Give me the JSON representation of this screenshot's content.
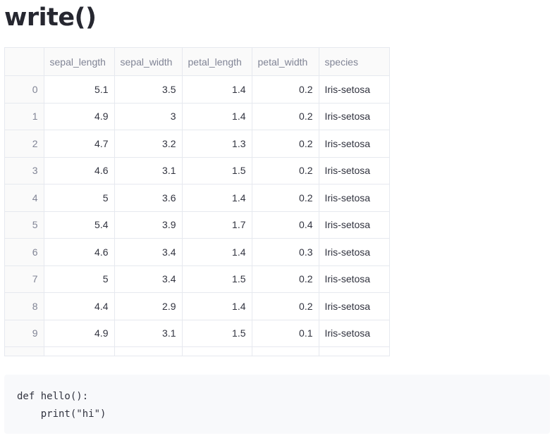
{
  "page": {
    "title": "write()"
  },
  "table": {
    "columns": [
      "",
      "sepal_length",
      "sepal_width",
      "petal_length",
      "petal_width",
      "species"
    ],
    "rows": [
      [
        "0",
        "5.1",
        "3.5",
        "1.4",
        "0.2",
        "Iris-setosa"
      ],
      [
        "1",
        "4.9",
        "3",
        "1.4",
        "0.2",
        "Iris-setosa"
      ],
      [
        "2",
        "4.7",
        "3.2",
        "1.3",
        "0.2",
        "Iris-setosa"
      ],
      [
        "3",
        "4.6",
        "3.1",
        "1.5",
        "0.2",
        "Iris-setosa"
      ],
      [
        "4",
        "5",
        "3.6",
        "1.4",
        "0.2",
        "Iris-setosa"
      ],
      [
        "5",
        "5.4",
        "3.9",
        "1.7",
        "0.4",
        "Iris-setosa"
      ],
      [
        "6",
        "4.6",
        "3.4",
        "1.4",
        "0.3",
        "Iris-setosa"
      ],
      [
        "7",
        "5",
        "3.4",
        "1.5",
        "0.2",
        "Iris-setosa"
      ],
      [
        "8",
        "4.4",
        "2.9",
        "1.4",
        "0.2",
        "Iris-setosa"
      ],
      [
        "9",
        "4.9",
        "3.1",
        "1.5",
        "0.1",
        "Iris-setosa"
      ]
    ]
  },
  "code": {
    "text": "def hello():\n    print(\"hi\")"
  }
}
